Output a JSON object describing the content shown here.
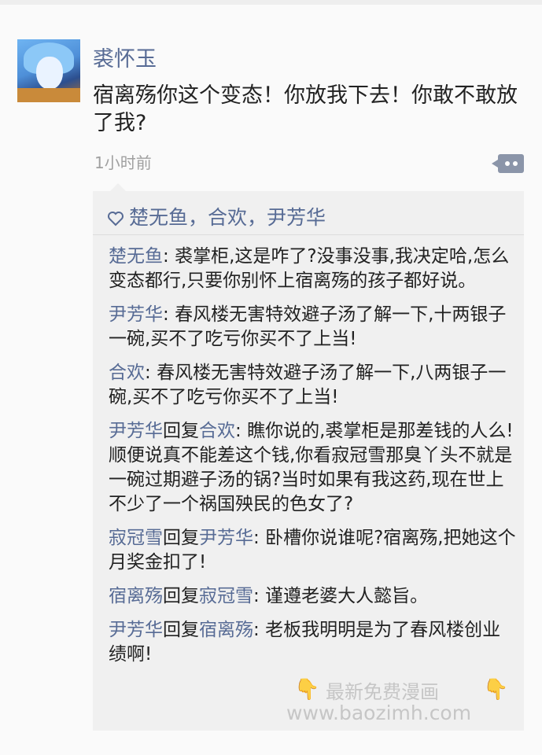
{
  "post": {
    "username": "裘怀玉",
    "text": "宿离殇你这个变态！你放我下去！你敢不敢放了我?",
    "time": "1小时前"
  },
  "likes": {
    "icon": "heart-outline-icon",
    "names": "楚无鱼，合欢，尹芳华"
  },
  "comments": [
    {
      "author": "楚无鱼",
      "reply_word": "",
      "reply_to": "",
      "separator": ": ",
      "text": "裘掌柜,这是咋了?没事没事,我决定哈,怎么变态都行,只要你别怀上宿离殇的孩子都好说。"
    },
    {
      "author": "尹芳华",
      "reply_word": "",
      "reply_to": "",
      "separator": ": ",
      "text": "春风楼无害特效避子汤了解一下,十两银子一碗,买不了吃亏你买不了上当!"
    },
    {
      "author": "合欢",
      "reply_word": "",
      "reply_to": "",
      "separator": ": ",
      "text": "春风楼无害特效避子汤了解一下,八两银子一碗,买不了吃亏你买不了上当!"
    },
    {
      "author": "尹芳华",
      "reply_word": "回复",
      "reply_to": "合欢",
      "separator": ": ",
      "text": "瞧你说的,裘掌柜是那差钱的人么!顺便说真不能差这个钱,你看寂冠雪那臭丫头不就是一碗过期避子汤的锅?当时如果有我这药,现在世上不少了一个祸国殃民的色女了?"
    },
    {
      "author": "寂冠雪",
      "reply_word": "回复",
      "reply_to": "尹芳华",
      "separator": ": ",
      "text": "卧槽你说谁呢?宿离殇,把她这个月奖金扣了!"
    },
    {
      "author": "宿离殇",
      "reply_word": "回复",
      "reply_to": "寂冠雪",
      "separator": ": ",
      "text": "谨遵老婆大人懿旨。"
    },
    {
      "author": "尹芳华",
      "reply_word": "回复",
      "reply_to": "宿离殇",
      "separator": ": ",
      "text": "老板我明明是为了春风楼创业绩啊!"
    }
  ],
  "watermark": {
    "line1": "最新免费漫画",
    "line2": "www.baozimh.com",
    "hand_glyph": "👇"
  },
  "colors": {
    "name": "#576b95",
    "text": "#222222",
    "time": "#a0a0a0",
    "panel": "#f0f0f0",
    "more_button": "#8b95a9"
  }
}
